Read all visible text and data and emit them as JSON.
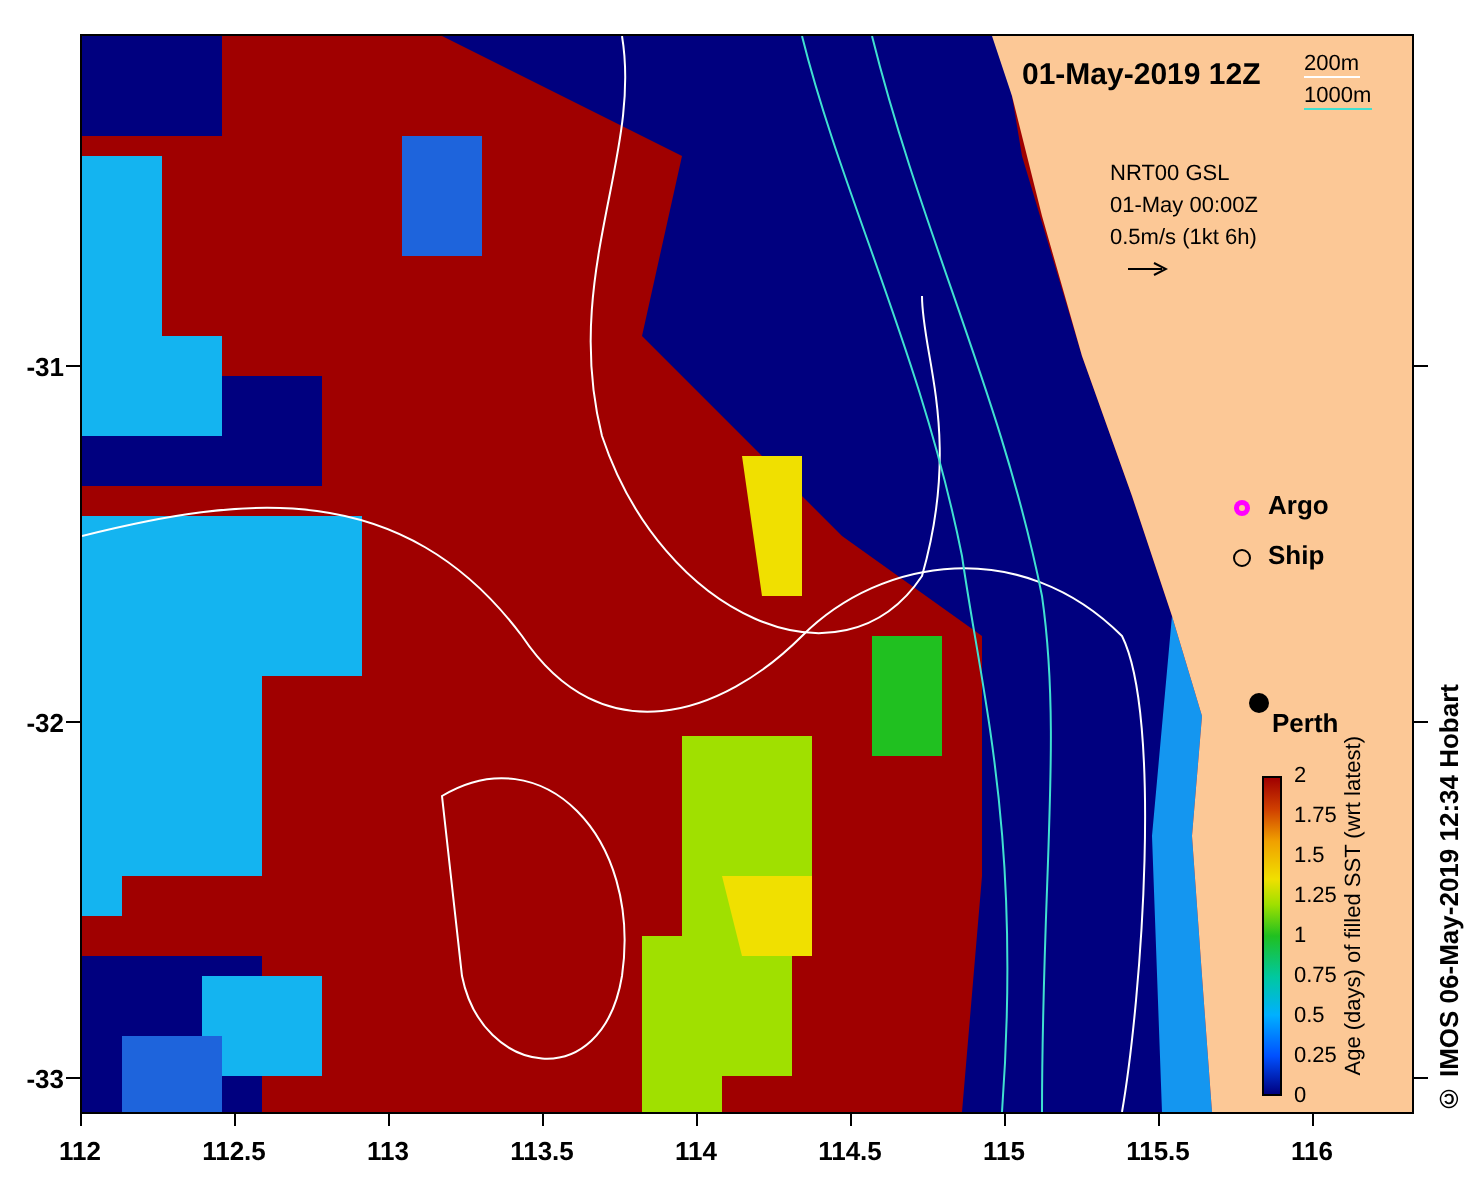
{
  "map": {
    "title": "01-May-2019 12Z",
    "depth_legend": [
      {
        "label": "200m",
        "color": "#ffffff"
      },
      {
        "label": "1000m",
        "color": "#40e0d0"
      }
    ],
    "current_note": [
      "NRT00 GSL",
      "01-May 00:00Z",
      "0.5m/s (1kt 6h)"
    ],
    "markers": [
      {
        "kind": "argo",
        "label": "Argo"
      },
      {
        "kind": "ship",
        "label": "Ship"
      }
    ],
    "places": [
      {
        "label": "Perth"
      }
    ],
    "colorbar": {
      "title": "Age (days) of filled SST (wrt latest)",
      "ticks": [
        "2",
        "1.75",
        "1.5",
        "1.25",
        "1",
        "0.75",
        "0.5",
        "0.25",
        "0"
      ]
    },
    "x_ticks": [
      "112",
      "112.5",
      "113",
      "113.5",
      "114",
      "114.5",
      "115",
      "115.5",
      "116"
    ],
    "y_ticks": [
      "-31",
      "-32",
      "-33"
    ]
  },
  "credit": "© IMOS 06-May-2019 12:34 Hobart"
}
